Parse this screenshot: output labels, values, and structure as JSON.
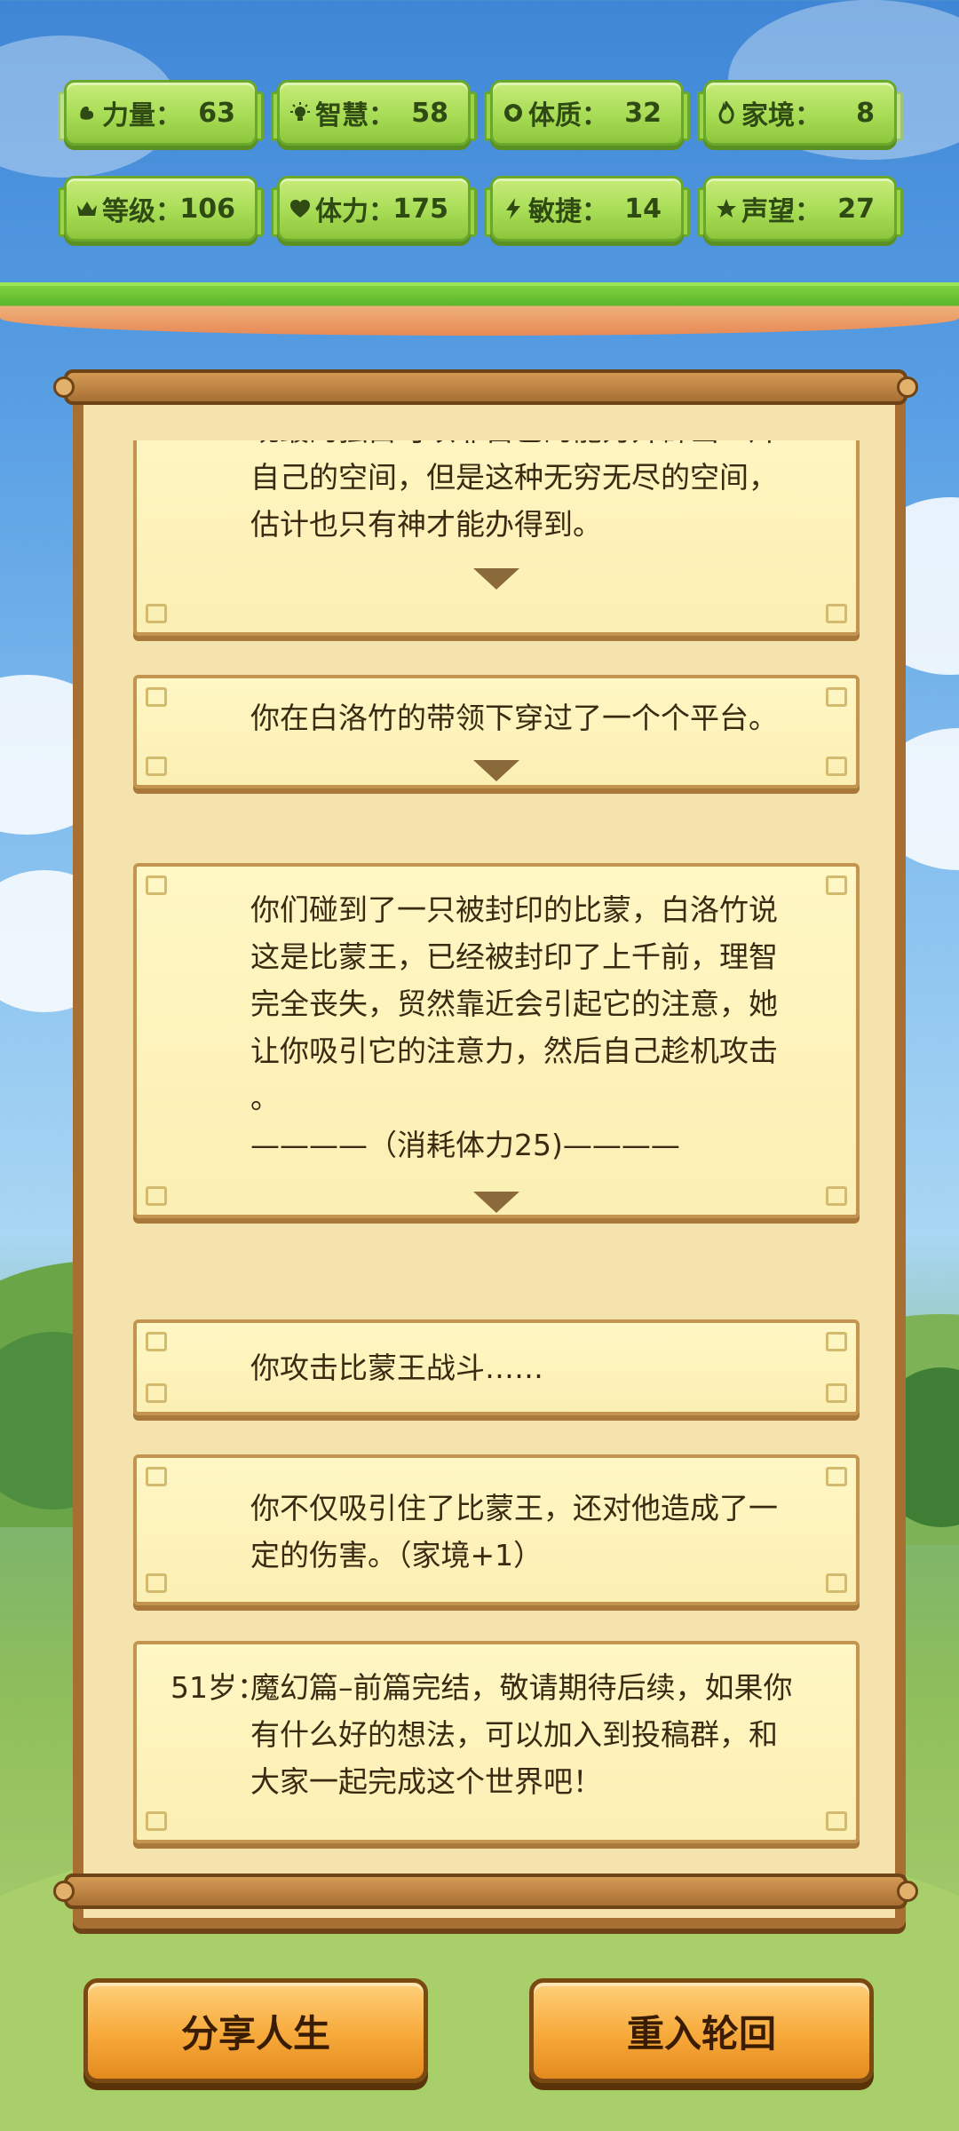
{
  "stats": [
    {
      "icon": "muscle-icon",
      "label": "力量：",
      "value": "63"
    },
    {
      "icon": "bulb-icon",
      "label": "智慧：",
      "value": "58"
    },
    {
      "icon": "shield-icon",
      "label": "体质：",
      "value": "32"
    },
    {
      "icon": "fire-icon",
      "label": "家境：",
      "value": "8"
    },
    {
      "icon": "crown-icon",
      "label": "等级：",
      "value": "106"
    },
    {
      "icon": "heart-icon",
      "label": "体力：",
      "value": "175"
    },
    {
      "icon": "lightning-icon",
      "label": "敏捷：",
      "value": "14"
    },
    {
      "icon": "star-icon",
      "label": "声望：",
      "value": "27"
    }
  ],
  "story": {
    "card1": {
      "line0": "现最的独白可以靠自己的能力开辟出一片",
      "line1": "自己的空间，但是这种无穷无尽的空间，",
      "line2": "估计也只有神才能办得到。"
    },
    "card2": {
      "line1": "你在白洛竹的带领下穿过了一个个平台。"
    },
    "card3": {
      "line1": "你们碰到了一只被封印的比蒙，白洛竹说",
      "line2": "这是比蒙王，已经被封印了上千前，理智",
      "line3": "完全丧失，贸然靠近会引起它的注意，她",
      "line4": "让你吸引它的注意力，然后自己趁机攻击",
      "line5": "。",
      "line6": "————（消耗体力25)————"
    },
    "card4": {
      "line1": "你攻击比蒙王战斗……"
    },
    "card5": {
      "line1": "你不仅吸引住了比蒙王，还对他造成了一",
      "line2": "定的伤害。（家境+1）"
    },
    "card6": {
      "age": "51岁：",
      "line1": "魔幻篇–前篇完结，敬请期待后续，如果你",
      "line2": "有什么好的想法，可以加入到投稿群，和",
      "line3": "大家一起完成这个世界吧！"
    }
  },
  "buttons": {
    "share": "分享人生",
    "restart": "重入轮回"
  },
  "colors": {
    "badge_green": "#a7dc55",
    "parchment": "#fff7c4",
    "wood": "#a86f33",
    "button_orange": "#f7a93a"
  }
}
